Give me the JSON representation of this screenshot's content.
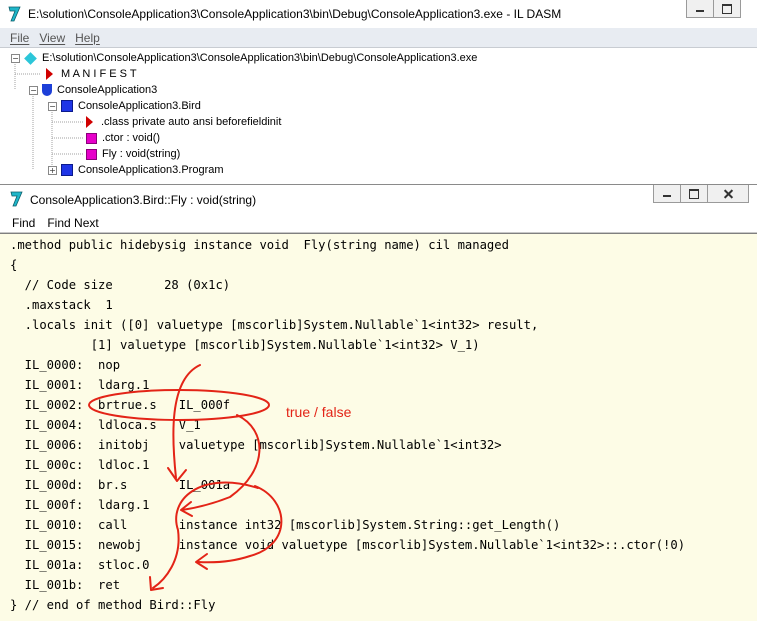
{
  "main_window": {
    "title": "E:\\solution\\ConsoleApplication3\\ConsoleApplication3\\bin\\Debug\\ConsoleApplication3.exe - IL DASM",
    "menu": [
      "File",
      "View",
      "Help"
    ],
    "tree": [
      {
        "label": "E:\\solution\\ConsoleApplication3\\ConsoleApplication3\\bin\\Debug\\ConsoleApplication3.exe",
        "icon": "diamond-icon",
        "expander": "−"
      },
      {
        "label": "M A N I F E S T",
        "icon": "red-triangle-icon"
      },
      {
        "label": "ConsoleApplication3",
        "icon": "namespace-shield-icon",
        "expander": "−"
      },
      {
        "label": "ConsoleApplication3.Bird",
        "icon": "class-icon",
        "expander": "−"
      },
      {
        "label": ".class private auto ansi beforefieldinit",
        "icon": "red-triangle-icon"
      },
      {
        "label": ".ctor : void()",
        "icon": "method-icon"
      },
      {
        "label": "Fly : void(string)",
        "icon": "method-icon"
      },
      {
        "label": "ConsoleApplication3.Program",
        "icon": "class-icon",
        "expander": "+"
      }
    ]
  },
  "child_window": {
    "title": "ConsoleApplication3.Bird::Fly : void(string)",
    "menu": [
      "Find",
      "Find Next"
    ],
    "code_lines": [
      ".method public hidebysig instance void  Fly(string name) cil managed",
      "{",
      "  // Code size       28 (0x1c)",
      "  .maxstack  1",
      "  .locals init ([0] valuetype [mscorlib]System.Nullable`1<int32> result,",
      "           [1] valuetype [mscorlib]System.Nullable`1<int32> V_1)",
      "  IL_0000:  nop",
      "  IL_0001:  ldarg.1",
      "  IL_0002:  brtrue.s   IL_000f",
      "  IL_0004:  ldloca.s   V_1",
      "  IL_0006:  initobj    valuetype [mscorlib]System.Nullable`1<int32>",
      "  IL_000c:  ldloc.1",
      "  IL_000d:  br.s       IL_001a",
      "  IL_000f:  ldarg.1",
      "  IL_0010:  call       instance int32 [mscorlib]System.String::get_Length()",
      "  IL_0015:  newobj     instance void valuetype [mscorlib]System.Nullable`1<int32>::.ctor(!0)",
      "  IL_001a:  stloc.0",
      "  IL_001b:  ret",
      "} // end of method Bird::Fly"
    ]
  },
  "annotation": {
    "text": "true / false",
    "color": "#e32417"
  },
  "colors": {
    "code_background": "#fdfce6",
    "menu_background": "#e8ecf2"
  }
}
